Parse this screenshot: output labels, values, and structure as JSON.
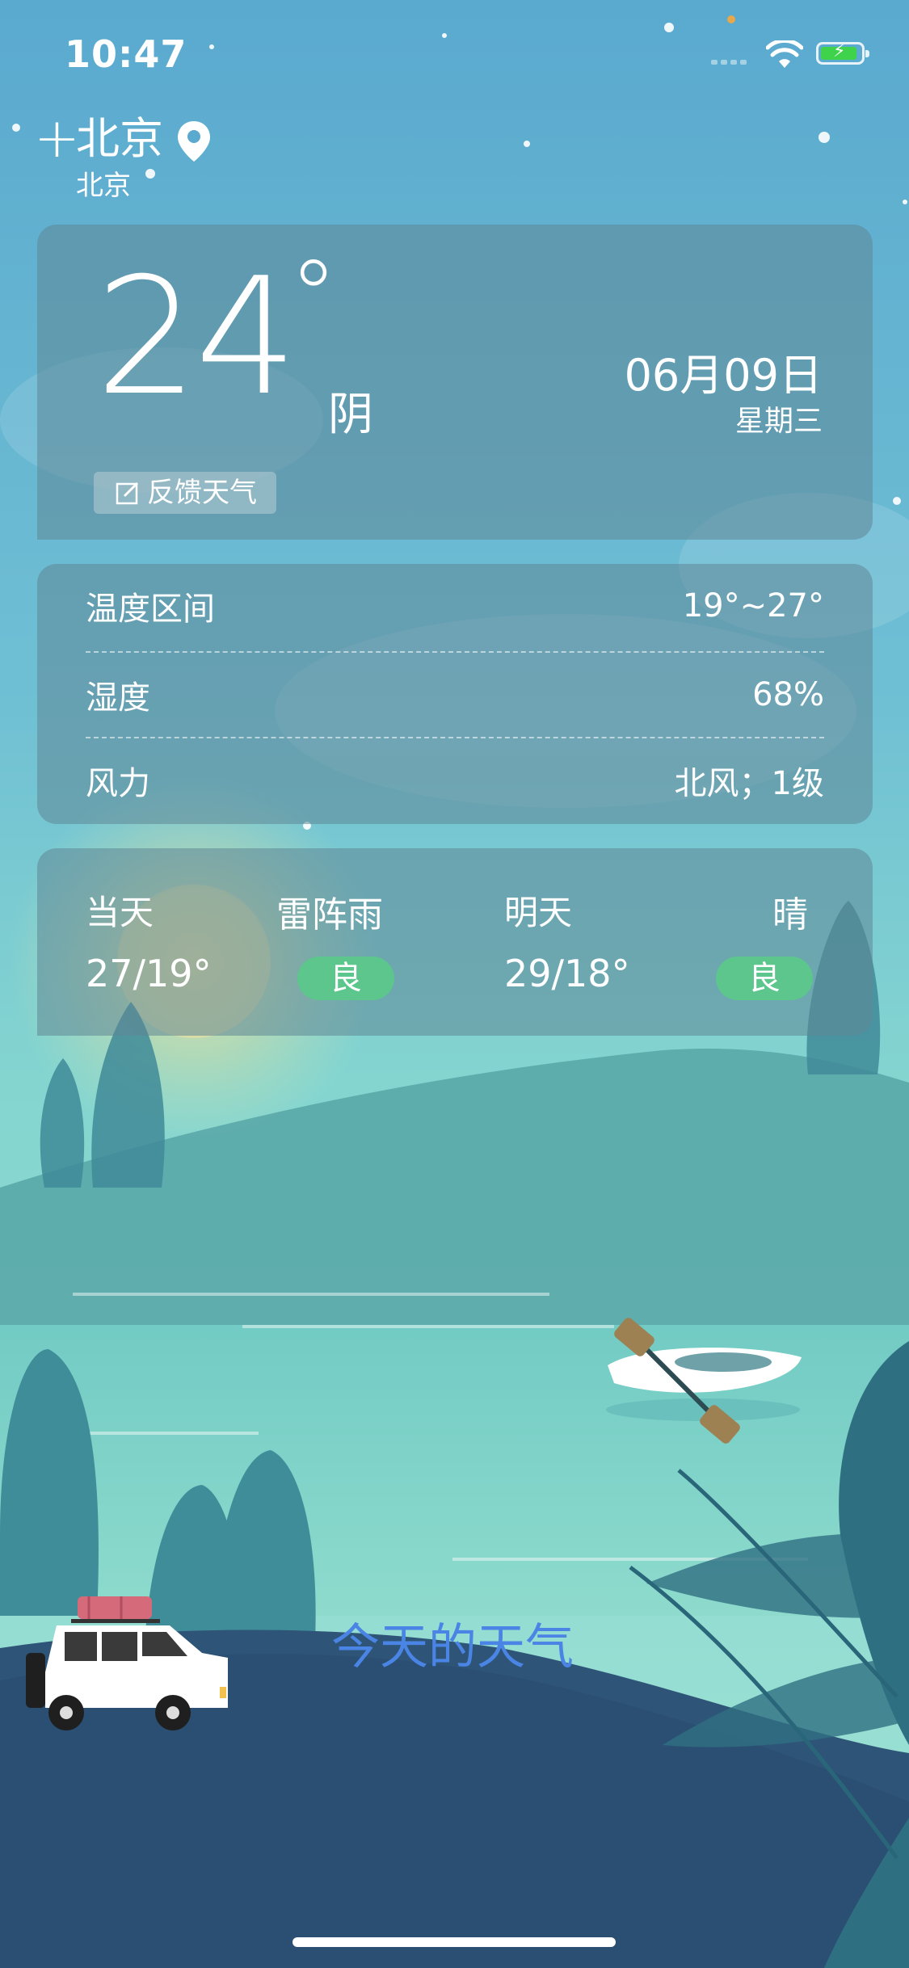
{
  "status": {
    "time": "10:47"
  },
  "header": {
    "add_icon": "plus-icon",
    "city": "北京",
    "district": "北京",
    "location_icon": "location-pin-icon"
  },
  "current": {
    "temperature": "24",
    "degree_symbol": "°",
    "condition": "阴",
    "date": "06月09日",
    "weekday": "星期三",
    "feedback_label": "反馈天气",
    "feedback_icon": "edit-icon"
  },
  "details": [
    {
      "label": "温度区间",
      "value": "19°~27°"
    },
    {
      "label": "湿度",
      "value": "68%"
    },
    {
      "label": "风力",
      "value": "北风；1级"
    }
  ],
  "forecast": [
    {
      "day": "当天",
      "condition": "雷阵雨",
      "range": "27/19°",
      "aqi": "良"
    },
    {
      "day": "明天",
      "condition": "晴",
      "range": "29/18°",
      "aqi": "良"
    }
  ],
  "bottom_title": "今天的天气",
  "colors": {
    "aqi_good": "#5cc68c",
    "accent_text": "#4a85e6",
    "battery": "#3fd34c"
  }
}
